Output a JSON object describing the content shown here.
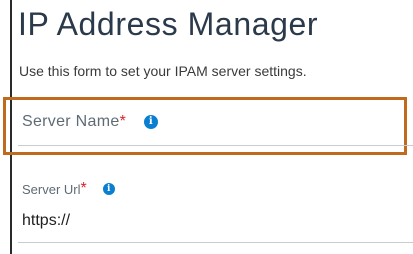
{
  "header": {
    "title": "IP Address Manager",
    "subtitle": "Use this form to set your IPAM server settings."
  },
  "form": {
    "server_name": {
      "label": "Server Name",
      "required_mark": "*",
      "info_icon": "info-icon",
      "value": ""
    },
    "server_url": {
      "label": "Server Url",
      "required_mark": "*",
      "info_icon": "info-icon",
      "value": "https://"
    }
  },
  "colors": {
    "focus_outline": "#c06a1e",
    "required": "#d8232a",
    "info_icon": "#0a7fd1"
  }
}
